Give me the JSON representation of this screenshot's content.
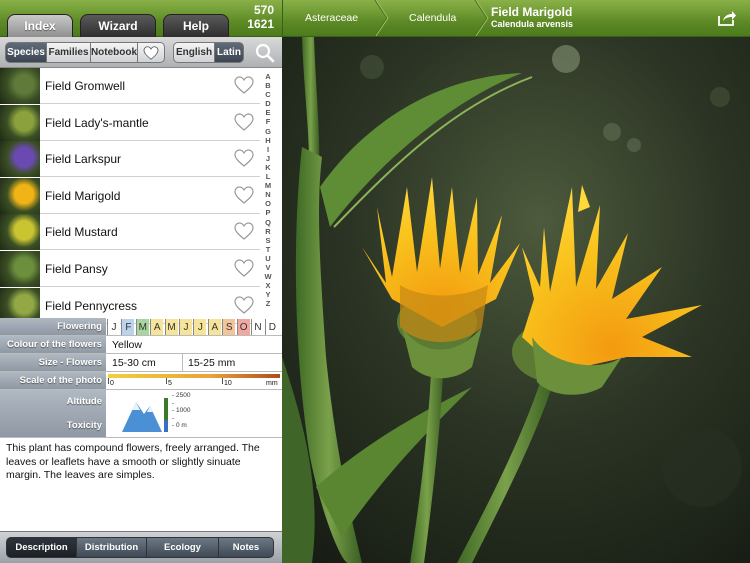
{
  "tabs": [
    {
      "label": "Index",
      "active": true
    },
    {
      "label": "Wizard",
      "active": false
    },
    {
      "label": "Help",
      "active": false
    }
  ],
  "counts": {
    "top": "570",
    "bottom": "1621"
  },
  "filters": {
    "groups": [
      "Species",
      "Families",
      "Notebook"
    ],
    "languages": [
      "English",
      "Latin"
    ]
  },
  "plants": [
    {
      "name": "Field Gromwell",
      "thumb_color": "#5f7a3a"
    },
    {
      "name": "Field Lady's-mantle",
      "thumb_color": "#8aa13d"
    },
    {
      "name": "Field Larkspur",
      "thumb_color": "#6a4ab0"
    },
    {
      "name": "Field Marigold",
      "thumb_color": "#f0b416"
    },
    {
      "name": "Field Mustard",
      "thumb_color": "#c9c531"
    },
    {
      "name": "Field Pansy",
      "thumb_color": "#6b8f3c"
    },
    {
      "name": "Field Pennycress",
      "thumb_color": "#93a845"
    }
  ],
  "alphabet": [
    "A",
    "B",
    "C",
    "D",
    "E",
    "F",
    "G",
    "H",
    "I",
    "J",
    "K",
    "L",
    "M",
    "N",
    "O",
    "P",
    "Q",
    "R",
    "S",
    "T",
    "U",
    "V",
    "W",
    "X",
    "Y",
    "Z"
  ],
  "info": {
    "flowering_label": "Flowering",
    "months": [
      "J",
      "F",
      "M",
      "A",
      "M",
      "J",
      "J",
      "A",
      "S",
      "O",
      "N",
      "D"
    ],
    "month_colors": [
      "#ffffff",
      "#bcd3ec",
      "#a9d6a0",
      "#f6e49a",
      "#f6e49a",
      "#f6e49a",
      "#f6e49a",
      "#f6e49a",
      "#f3c39a",
      "#f0a7a0",
      "#ffffff",
      "#ffffff"
    ],
    "colour_label": "Colour of the flowers",
    "colour_value": "Yellow",
    "size_label": "Size - Flowers",
    "size_value_1": "15-30 cm",
    "size_value_2": "15-25 mm",
    "scale_label": "Scale of the photo",
    "scale_ticks": [
      "0",
      "5",
      "10",
      "mm"
    ],
    "altitude_label": "Altitude",
    "toxicity_label": "Toxicity",
    "altitude_ticks": [
      "- 2500",
      "-",
      "- 1000",
      "-",
      "- 0 m"
    ]
  },
  "description": "This plant has compound flowers, freely arranged. The leaves or leaflets have a smooth or slightly sinuate margin. The leaves are simples.",
  "bottom_tabs": [
    {
      "label": "Description",
      "active": true
    },
    {
      "label": "Distribution",
      "active": false
    },
    {
      "label": "Ecology",
      "active": false
    },
    {
      "label": "Notes",
      "active": false
    }
  ],
  "breadcrumb": {
    "family": "Asteraceae",
    "genus": "Calendula",
    "common_name": "Field Marigold",
    "latin_name": "Calendula arvensis"
  },
  "icons": {
    "search": "search-icon",
    "heart": "heart-icon",
    "share": "share-icon",
    "altitude": "mountain-icon"
  },
  "colors": {
    "brand_green": "#5d8a26",
    "flower_yellow": "#f7b51c"
  }
}
